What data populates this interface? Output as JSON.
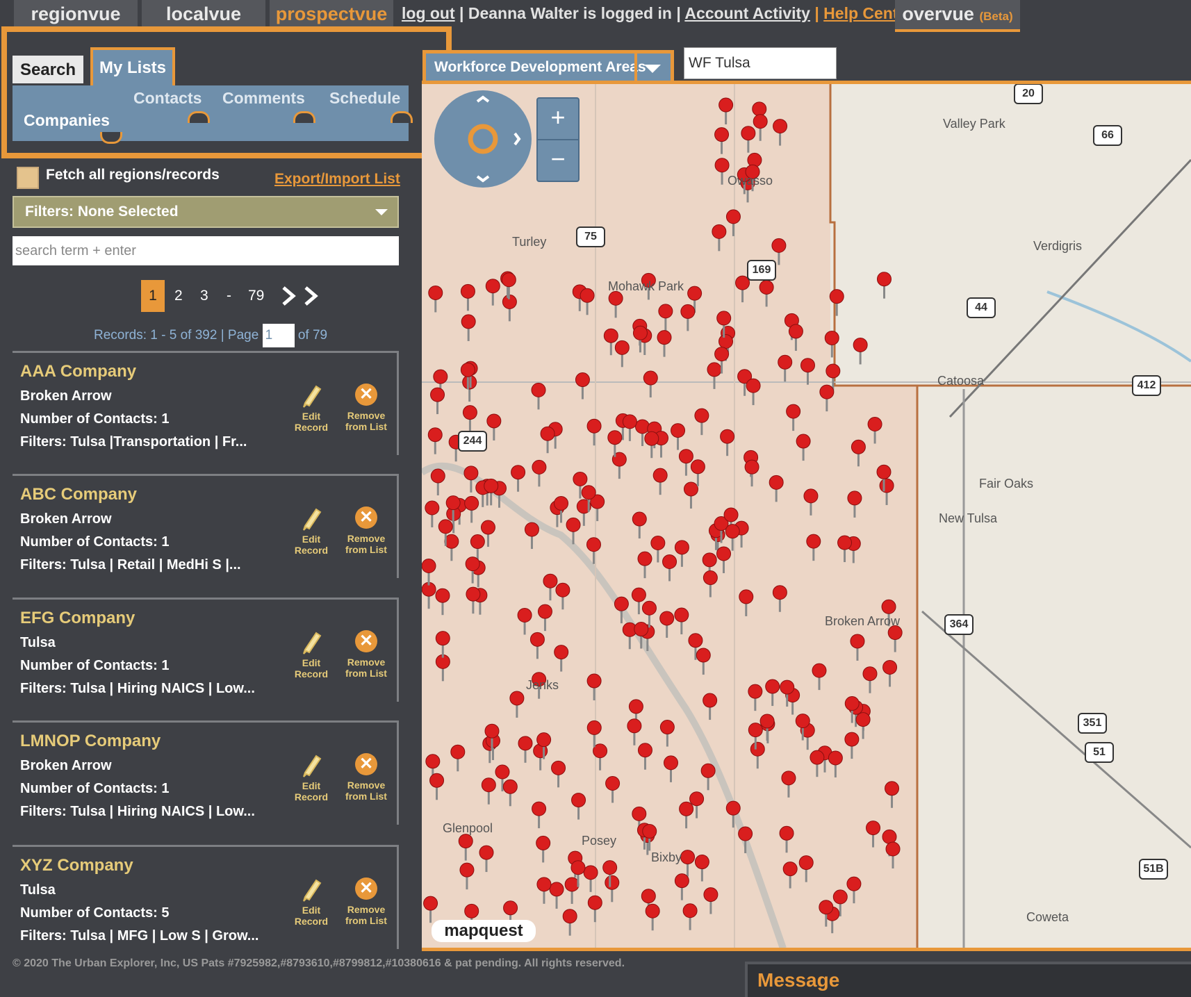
{
  "nav": {
    "tabs": [
      {
        "label": "regionvue"
      },
      {
        "label": "localvue"
      },
      {
        "label": "prospectvue"
      }
    ],
    "logout": "log out",
    "logged_in_text": "Deanna Walter is logged in",
    "account_activity": "Account Activity",
    "help_center": "Help Center",
    "overvue": "overvue",
    "overvue_badge": "(Beta)"
  },
  "subtabs": {
    "search": "Search",
    "my_lists": "My Lists",
    "companies": "Companies",
    "contacts": "Contacts",
    "comments": "Comments",
    "schedule": "Schedule"
  },
  "sidebar": {
    "fetch_all_label": "Fetch all regions/records",
    "export_link": "Export/Import List",
    "filters_label": "Filters: None Selected",
    "search_placeholder": "search term + enter",
    "pagination": {
      "pages": [
        "1",
        "2",
        "3",
        "-",
        "79"
      ],
      "records_text": "Records: 1 - 5 of 392 | Page",
      "page_value": "1",
      "of_text": "of 79"
    },
    "cards": [
      {
        "name": "AAA Company",
        "city": "Broken Arrow",
        "contacts": "Number of Contacts: 1",
        "filters": "Filters: Tulsa |Transportation | Fr..."
      },
      {
        "name": "ABC Company",
        "city": "Broken Arrow",
        "contacts": "Number of Contacts: 1",
        "filters": "Filters: Tulsa | Retail | MedHi S |..."
      },
      {
        "name": "EFG Company",
        "city": "Tulsa",
        "contacts": "Number of Contacts: 1",
        "filters": "Filters: Tulsa | Hiring NAICS | Low..."
      },
      {
        "name": "LMNOP Company",
        "city": "Broken Arrow",
        "contacts": "Number of Contacts: 1",
        "filters": "Filters: Tulsa | Hiring NAICS | Low..."
      },
      {
        "name": "XYZ Company",
        "city": "Tulsa",
        "contacts": "Number of Contacts: 5",
        "filters": "Filters: Tulsa | MFG | Low S | Grow..."
      }
    ],
    "edit_label_1": "Edit",
    "edit_label_2": "Record",
    "remove_label_1": "Remove",
    "remove_label_2": "from List"
  },
  "map": {
    "area_select": "Workforce Development Areas",
    "area_value": "WF Tulsa",
    "zoom_in": "+",
    "zoom_out": "−",
    "places": [
      "Valley Park",
      "Verdigris",
      "Catoosa",
      "Fair Oaks",
      "New Tulsa",
      "Coweta",
      "Owasso",
      "Turley",
      "Mohawk Park",
      "Broken Arrow",
      "Jenks",
      "Glenpool",
      "Posey",
      "Bixby"
    ],
    "shields": [
      "66",
      "75",
      "169",
      "44",
      "412",
      "244",
      "364",
      "351",
      "51",
      "51B",
      "20"
    ],
    "logo": "mapquest"
  },
  "footer": "© 2020 The Urban Explorer, Inc, US Pats #7925982,#8793610,#8799812,#10380616 & pat pending. All rights reserved.",
  "message_title": "Message",
  "colors": {
    "accent": "#e8983a",
    "panel": "#3e4045",
    "tab_blue": "#6f8fab",
    "company_gold": "#e6cb79",
    "pin_red": "#d91e1e"
  }
}
